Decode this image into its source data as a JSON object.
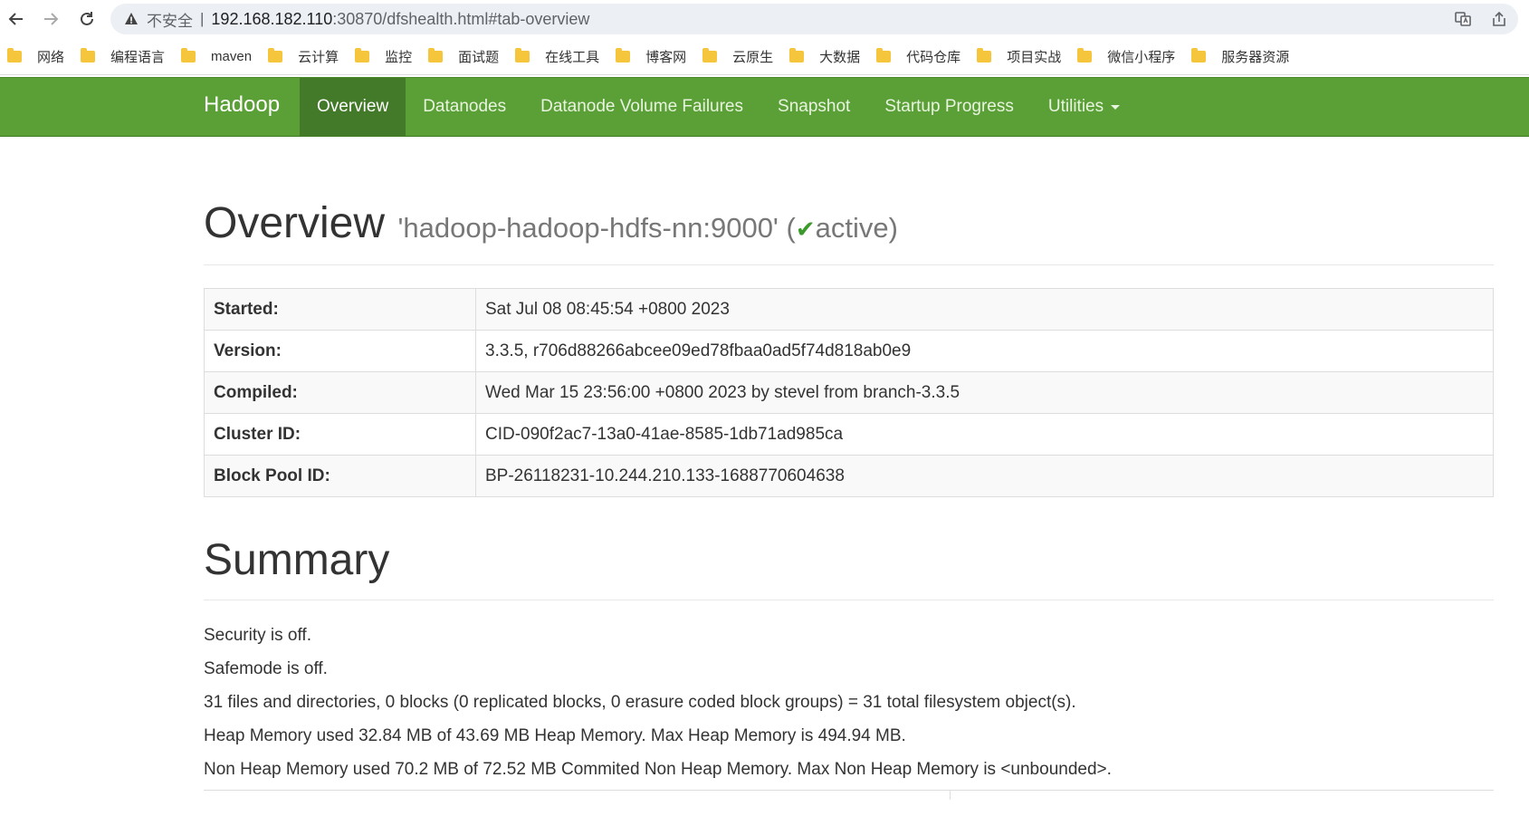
{
  "browser": {
    "insecure_label": "不安全",
    "url_host": "192.168.182.110",
    "url_rest": ":30870/dfshealth.html#tab-overview",
    "icons": {
      "back": "arrow-left-icon",
      "forward": "arrow-right-icon",
      "reload": "reload-icon",
      "warning": "warning-triangle-icon",
      "translate": "translate-icon",
      "share": "share-icon"
    }
  },
  "bookmarks": [
    {
      "label": "网络"
    },
    {
      "label": "编程语言"
    },
    {
      "label": "maven"
    },
    {
      "label": "云计算"
    },
    {
      "label": "监控"
    },
    {
      "label": "面试题"
    },
    {
      "label": "在线工具"
    },
    {
      "label": "博客网"
    },
    {
      "label": "云原生"
    },
    {
      "label": "大数据"
    },
    {
      "label": "代码仓库"
    },
    {
      "label": "项目实战"
    },
    {
      "label": "微信小程序"
    },
    {
      "label": "服务器资源"
    }
  ],
  "navbar": {
    "brand": "Hadoop",
    "items": [
      {
        "label": "Overview",
        "active": true
      },
      {
        "label": "Datanodes"
      },
      {
        "label": "Datanode Volume Failures"
      },
      {
        "label": "Snapshot"
      },
      {
        "label": "Startup Progress"
      },
      {
        "label": "Utilities"
      }
    ],
    "colors": {
      "bar": "#5ba036",
      "active": "#437a29"
    }
  },
  "overview": {
    "title": "Overview",
    "host": "'hadoop-hadoop-hdfs-nn:9000'",
    "state_open": "(",
    "state": "active)",
    "rows": [
      {
        "key": "Started:",
        "value": "Sat Jul 08 08:45:54 +0800 2023"
      },
      {
        "key": "Version:",
        "value": "3.3.5, r706d88266abcee09ed78fbaa0ad5f74d818ab0e9"
      },
      {
        "key": "Compiled:",
        "value": "Wed Mar 15 23:56:00 +0800 2023 by stevel from branch-3.3.5"
      },
      {
        "key": "Cluster ID:",
        "value": "CID-090f2ac7-13a0-41ae-8585-1db71ad985ca"
      },
      {
        "key": "Block Pool ID:",
        "value": "BP-26118231-10.244.210.133-1688770604638"
      }
    ]
  },
  "summary": {
    "title": "Summary",
    "lines": [
      "Security is off.",
      "Safemode is off.",
      "31 files and directories, 0 blocks (0 replicated blocks, 0 erasure coded block groups) = 31 total filesystem object(s).",
      "Heap Memory used 32.84 MB of 43.69 MB Heap Memory. Max Heap Memory is 494.94 MB.",
      "Non Heap Memory used 70.2 MB of 72.52 MB Commited Non Heap Memory. Max Non Heap Memory is <unbounded>."
    ]
  }
}
